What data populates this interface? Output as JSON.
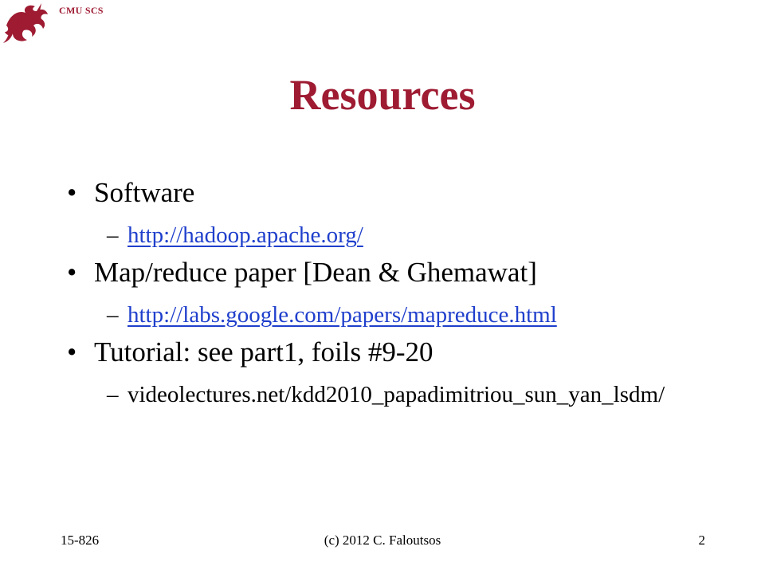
{
  "header": {
    "org_label": "CMU SCS",
    "logo_icon": "dragon-icon",
    "accent_color": "#9e1b32"
  },
  "title": "Resources",
  "bullets": [
    {
      "text": "Software",
      "sub": {
        "text": "http://hadoop.apache.org/",
        "is_link": true
      }
    },
    {
      "text": "Map/reduce paper [Dean & Ghemawat]",
      "sub": {
        "text": "http://labs.google.com/papers/mapreduce.html",
        "is_link": true
      }
    },
    {
      "text": "Tutorial: see part1, foils #9-20",
      "sub": {
        "text": "videolectures.net/kdd2010_papadimitriou_sun_yan_lsdm/",
        "is_link": false
      }
    }
  ],
  "markers": {
    "bullet": "•",
    "sub": "–"
  },
  "footer": {
    "left": "15-826",
    "center": "(c) 2012  C. Faloutsos",
    "right": "2"
  },
  "link_color": "#1f3fcc"
}
